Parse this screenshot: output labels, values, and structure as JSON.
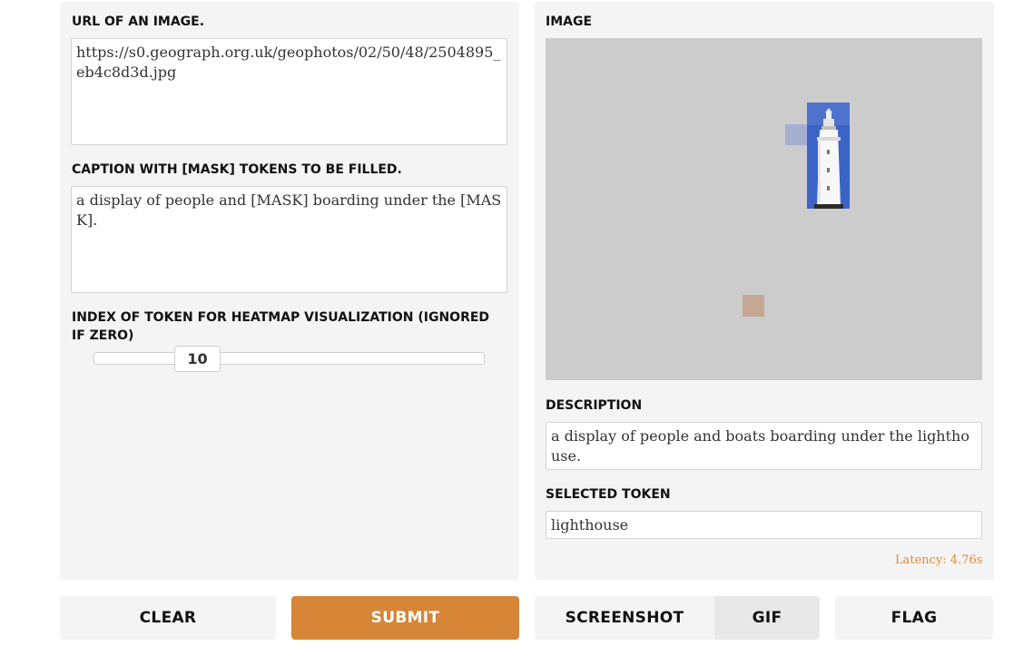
{
  "inputs": {
    "url_label": "URL OF AN IMAGE.",
    "url_value": "https://s0.geograph.org.uk/geophotos/02/50/48/2504895_eb4c8d3d.jpg",
    "caption_label": "CAPTION WITH [MASK] TOKENS TO BE FILLED.",
    "caption_value": "a display of people and [MASK] boarding under the [MASK].",
    "index_label": "INDEX OF TOKEN FOR HEATMAP VISUALIZATION (IGNORED IF ZERO)",
    "index_value": "10"
  },
  "outputs": {
    "image_label": "IMAGE",
    "description_label": "DESCRIPTION",
    "description_value": "a display of people and boats boarding under the lighthouse.",
    "selected_token_label": "SELECTED TOKEN",
    "selected_token_value": "lighthouse",
    "latency": "Latency: 4.76s"
  },
  "buttons": {
    "clear": "CLEAR",
    "submit": "SUBMIT",
    "screenshot": "SCREENSHOT",
    "gif": "GIF",
    "flag": "FLAG"
  },
  "colors": {
    "accent": "#d78536",
    "panel_bg": "#f4f4f4",
    "latency": "#e08a3c"
  }
}
